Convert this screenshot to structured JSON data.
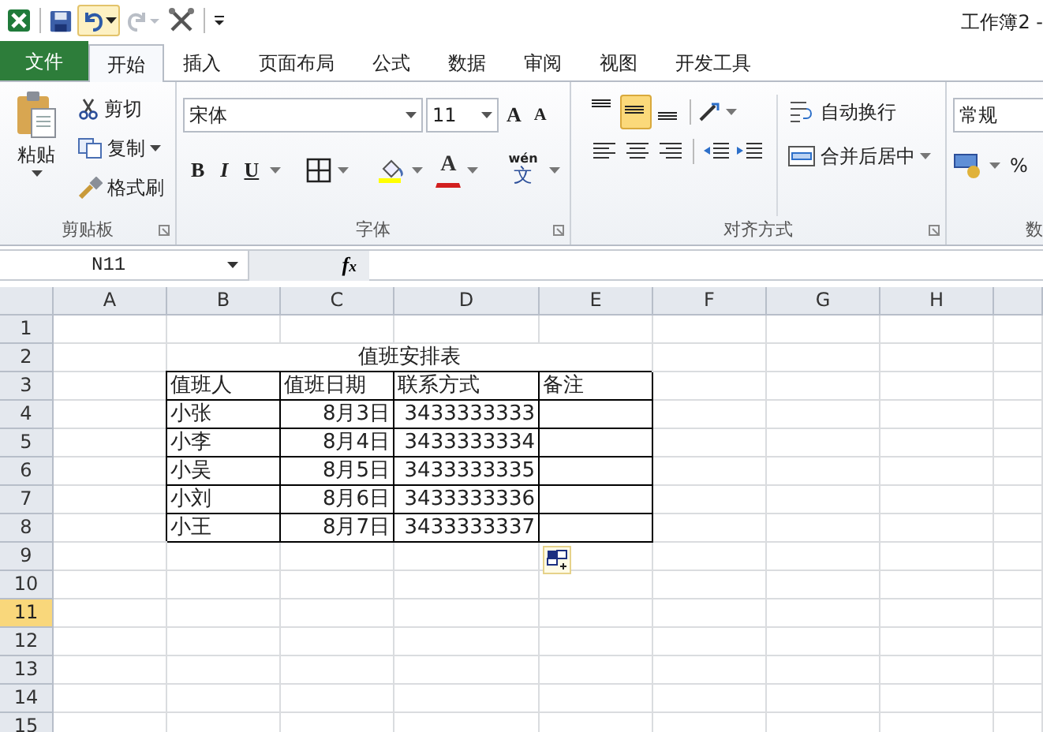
{
  "window": {
    "title": "工作簿2 -"
  },
  "quick_access": {
    "redo_disabled": true
  },
  "tabs": [
    {
      "label": "文件",
      "kind": "file",
      "selected": false
    },
    {
      "label": "开始",
      "kind": "tab",
      "selected": true
    },
    {
      "label": "插入",
      "kind": "tab",
      "selected": false
    },
    {
      "label": "页面布局",
      "kind": "tab",
      "selected": false
    },
    {
      "label": "公式",
      "kind": "tab",
      "selected": false
    },
    {
      "label": "数据",
      "kind": "tab",
      "selected": false
    },
    {
      "label": "审阅",
      "kind": "tab",
      "selected": false
    },
    {
      "label": "视图",
      "kind": "tab",
      "selected": false
    },
    {
      "label": "开发工具",
      "kind": "tab",
      "selected": false
    }
  ],
  "ribbon": {
    "clipboard": {
      "label": "剪贴板",
      "paste": "粘贴",
      "cut": "剪切",
      "copy": "复制",
      "format_painter": "格式刷"
    },
    "font": {
      "label": "字体",
      "font_name": "宋体",
      "font_size": "11",
      "grow": "A",
      "shrink": "A",
      "bold": "B",
      "italic": "I",
      "underline": "U",
      "font_color": "A",
      "phonetic": "wén",
      "phonetic_char": "文"
    },
    "alignment": {
      "label": "对齐方式",
      "wrap_text": "自动换行",
      "merge_center": "合并后居中",
      "vertical_align": [
        {
          "selected": false
        },
        {
          "selected": true
        },
        {
          "selected": false
        }
      ]
    },
    "number": {
      "label": "数",
      "format": "常规",
      "percent": "%"
    }
  },
  "formula_bar": {
    "name_box": "N11",
    "fx": "f$_{x}$"
  },
  "sheet": {
    "columns": [
      {
        "label": "A"
      },
      {
        "label": "B"
      },
      {
        "label": "C"
      },
      {
        "label": "D"
      },
      {
        "label": "E"
      },
      {
        "label": "F"
      },
      {
        "label": "G"
      },
      {
        "label": "H"
      }
    ],
    "rows": [
      {
        "number": "1",
        "selected": false,
        "kind": "blank",
        "cells": []
      },
      {
        "number": "2",
        "selected": false,
        "kind": "title",
        "cells": [
          "",
          "值班安排表"
        ]
      },
      {
        "number": "3",
        "selected": false,
        "kind": "header",
        "cells": [
          "",
          "值班人",
          "值班日期",
          "联系方式",
          "备注"
        ]
      },
      {
        "number": "4",
        "selected": false,
        "kind": "record",
        "cells": [
          "",
          "小张",
          "8月3日",
          "3433333333",
          ""
        ]
      },
      {
        "number": "5",
        "selected": false,
        "kind": "record",
        "cells": [
          "",
          "小李",
          "8月4日",
          "3433333334",
          ""
        ]
      },
      {
        "number": "6",
        "selected": false,
        "kind": "record",
        "cells": [
          "",
          "小吴",
          "8月5日",
          "3433333335",
          ""
        ]
      },
      {
        "number": "7",
        "selected": false,
        "kind": "record",
        "cells": [
          "",
          "小刘",
          "8月6日",
          "3433333336",
          ""
        ]
      },
      {
        "number": "8",
        "selected": false,
        "kind": "record",
        "cells": [
          "",
          "小王",
          "8月7日",
          "3433333337",
          ""
        ]
      },
      {
        "number": "9",
        "selected": false,
        "kind": "blank",
        "cells": []
      },
      {
        "number": "10",
        "selected": false,
        "kind": "blank",
        "cells": []
      },
      {
        "number": "11",
        "selected": true,
        "kind": "blank",
        "cells": []
      },
      {
        "number": "12",
        "selected": false,
        "kind": "blank",
        "cells": []
      },
      {
        "number": "13",
        "selected": false,
        "kind": "blank",
        "cells": []
      },
      {
        "number": "14",
        "selected": false,
        "kind": "blank",
        "cells": []
      },
      {
        "number": "15",
        "selected": false,
        "kind": "blank",
        "cells": []
      }
    ]
  }
}
